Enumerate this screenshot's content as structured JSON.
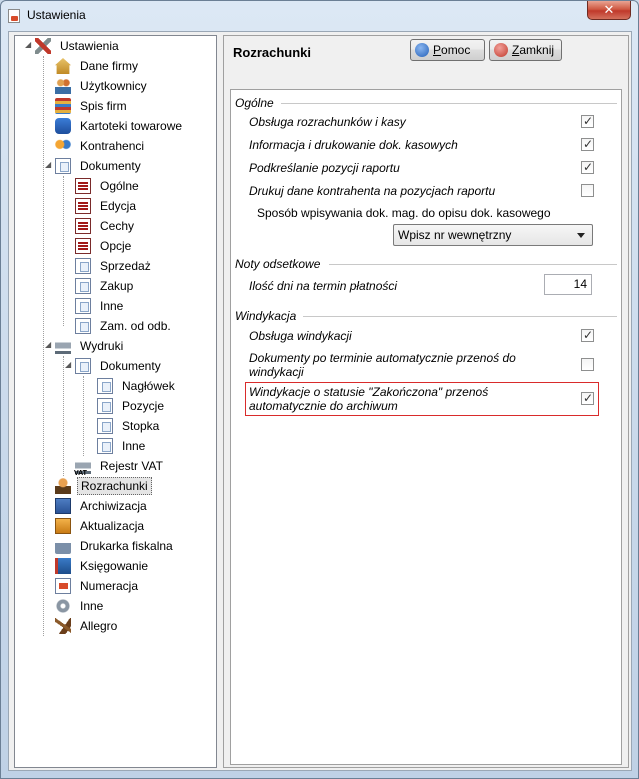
{
  "window": {
    "title": "Ustawienia",
    "close_glyph": "✕"
  },
  "tree": {
    "items": [
      {
        "label": "Ustawienia",
        "icon": "tools-icon"
      },
      {
        "label": "Dane firmy",
        "icon": "house-icon"
      },
      {
        "label": "Użytkownicy",
        "icon": "users-icon"
      },
      {
        "label": "Spis firm",
        "icon": "books-icon"
      },
      {
        "label": "Kartoteki towarowe",
        "icon": "database-icon"
      },
      {
        "label": "Kontrahenci",
        "icon": "people-icon"
      },
      {
        "label": "Dokumenty",
        "icon": "document-icon"
      },
      {
        "label": "Ogólne",
        "icon": "document-red-icon"
      },
      {
        "label": "Edycja",
        "icon": "document-red-icon"
      },
      {
        "label": "Cechy",
        "icon": "document-red-icon"
      },
      {
        "label": "Opcje",
        "icon": "document-red-icon"
      },
      {
        "label": "Sprzedaż",
        "icon": "document-icon"
      },
      {
        "label": "Zakup",
        "icon": "document-icon"
      },
      {
        "label": "Inne",
        "icon": "document-icon"
      },
      {
        "label": "Zam. od odb.",
        "icon": "document-icon"
      },
      {
        "label": "Wydruki",
        "icon": "printer-icon"
      },
      {
        "label": "Dokumenty",
        "icon": "document-icon"
      },
      {
        "label": "Nagłówek",
        "icon": "document-icon"
      },
      {
        "label": "Pozycje",
        "icon": "document-icon"
      },
      {
        "label": "Stopka",
        "icon": "document-icon"
      },
      {
        "label": "Inne",
        "icon": "document-icon"
      },
      {
        "label": "Rejestr VAT",
        "icon": "vat-printer-icon",
        "tag": "VAT"
      },
      {
        "label": "Rozrachunki",
        "icon": "person-icon",
        "selected": true
      },
      {
        "label": "Archiwizacja",
        "icon": "archive-icon"
      },
      {
        "label": "Aktualizacja",
        "icon": "box-icon"
      },
      {
        "label": "Drukarka fiskalna",
        "icon": "fiscal-printer-icon"
      },
      {
        "label": "Księgowanie",
        "icon": "ledger-icon"
      },
      {
        "label": "Numeracja",
        "icon": "numbering-icon"
      },
      {
        "label": "Inne",
        "icon": "gear-icon"
      },
      {
        "label": "Allegro",
        "icon": "gavel-icon"
      }
    ]
  },
  "panel": {
    "title": "Rozrachunki",
    "help_button": {
      "underlined": "P",
      "rest": "omoc"
    },
    "close_button": {
      "underlined": "Z",
      "rest": "amknij"
    }
  },
  "groups": {
    "ogolne": {
      "label": "Ogólne",
      "options": [
        {
          "label": "Obsługa rozrachunków i kasy",
          "checked": true
        },
        {
          "label": "Informacja i drukowanie  dok. kasowych",
          "checked": true
        },
        {
          "label": "Podkreślanie pozycji raportu",
          "checked": true
        },
        {
          "label": "Drukuj dane kontrahenta na pozycjach raportu",
          "checked": false
        }
      ],
      "method_label": "Sposób wpisywania dok. mag. do opisu dok. kasowego",
      "method_value": "Wpisz nr wewnętrzny"
    },
    "noty": {
      "label": "Noty odsetkowe",
      "days_label": "Ilość dni na termin płatności",
      "days_value": "14"
    },
    "windykacja": {
      "label": "Windykacja",
      "options": [
        {
          "label": "Obsługa windykacji",
          "checked": true
        },
        {
          "label": "Dokumenty po terminie automatycznie przenoś do windykacji",
          "checked": false
        },
        {
          "label": "Windykacje o statusie \"Zakończona\" przenoś automatycznie do archiwum",
          "checked": true
        }
      ]
    }
  }
}
